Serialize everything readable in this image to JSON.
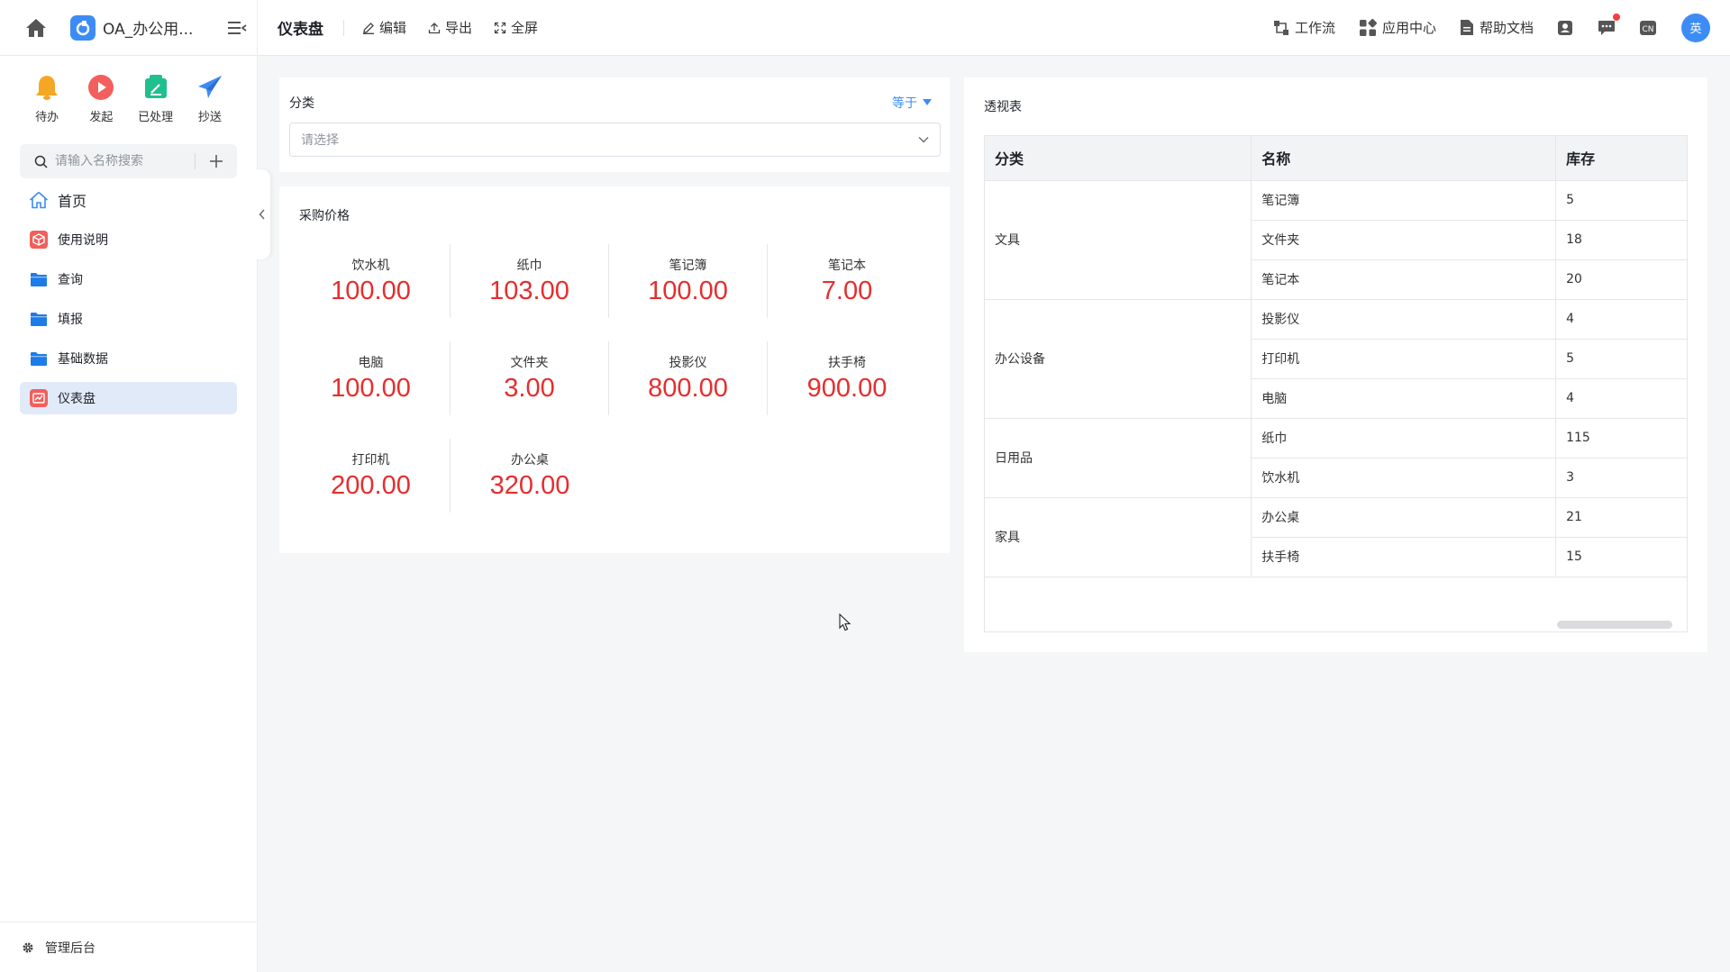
{
  "app": {
    "name": "OA_办公用...",
    "page_title": "仪表盘",
    "colors": {
      "accent": "#3d8cf5",
      "value_red": "#e52e2e",
      "active_bg": "#e1eaf8"
    }
  },
  "toolbar": {
    "edit_label": "编辑",
    "export_label": "导出",
    "fullscreen_label": "全屏"
  },
  "header_right": {
    "workflow_label": "工作流",
    "app_center_label": "应用中心",
    "help_label": "帮助文档",
    "avatar_text": "英"
  },
  "sidebar": {
    "quick": [
      {
        "label": "待办",
        "icon": "bell-icon"
      },
      {
        "label": "发起",
        "icon": "play-icon"
      },
      {
        "label": "已处理",
        "icon": "processed-icon"
      },
      {
        "label": "抄送",
        "icon": "send-icon"
      }
    ],
    "search_placeholder": "请输入名称搜索",
    "items": [
      {
        "label": "首页",
        "icon": "home-icon"
      },
      {
        "label": "使用说明",
        "icon": "guide-icon"
      },
      {
        "label": "查询",
        "icon": "folder-icon"
      },
      {
        "label": "填报",
        "icon": "folder-icon"
      },
      {
        "label": "基础数据",
        "icon": "folder-icon"
      },
      {
        "label": "仪表盘",
        "icon": "dashboard-icon"
      }
    ],
    "footer_label": "管理后台"
  },
  "filter": {
    "label": "分类",
    "operator": "等于",
    "placeholder": "请选择"
  },
  "stats": {
    "title": "采购价格",
    "items": [
      {
        "label": "饮水机",
        "value": "100.00"
      },
      {
        "label": "纸巾",
        "value": "103.00"
      },
      {
        "label": "笔记簿",
        "value": "100.00"
      },
      {
        "label": "笔记本",
        "value": "7.00"
      },
      {
        "label": "电脑",
        "value": "100.00"
      },
      {
        "label": "文件夹",
        "value": "3.00"
      },
      {
        "label": "投影仪",
        "value": "800.00"
      },
      {
        "label": "扶手椅",
        "value": "900.00"
      },
      {
        "label": "打印机",
        "value": "200.00"
      },
      {
        "label": "办公桌",
        "value": "320.00"
      }
    ]
  },
  "pivot": {
    "title": "透视表",
    "headers": [
      "分类",
      "名称",
      "库存"
    ],
    "groups": [
      {
        "category": "文具",
        "rows": [
          {
            "name": "笔记簿",
            "stock": "5"
          },
          {
            "name": "文件夹",
            "stock": "18"
          },
          {
            "name": "笔记本",
            "stock": "20"
          }
        ]
      },
      {
        "category": "办公设备",
        "rows": [
          {
            "name": "投影仪",
            "stock": "4"
          },
          {
            "name": "打印机",
            "stock": "5"
          },
          {
            "name": "电脑",
            "stock": "4"
          }
        ]
      },
      {
        "category": "日用品",
        "rows": [
          {
            "name": "纸巾",
            "stock": "115"
          },
          {
            "name": "饮水机",
            "stock": "3"
          }
        ]
      },
      {
        "category": "家具",
        "rows": [
          {
            "name": "办公桌",
            "stock": "21"
          },
          {
            "name": "扶手椅",
            "stock": "15"
          }
        ]
      }
    ]
  }
}
